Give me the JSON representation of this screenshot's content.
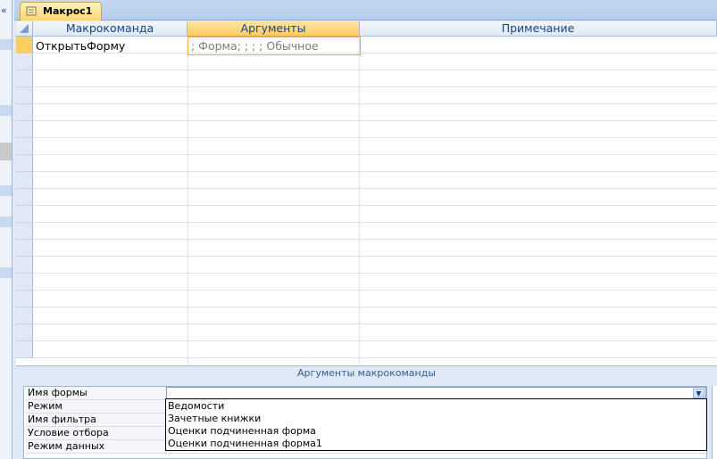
{
  "nav": {
    "collapse_glyph": "«"
  },
  "tab": {
    "title": "Макрос1",
    "icon": "macro-scroll-icon"
  },
  "grid": {
    "headers": {
      "action": "Макрокоманда",
      "arguments": "Аргументы",
      "comment": "Примечание"
    },
    "rows": [
      {
        "action": "ОткрытьФорму",
        "arguments": "; Форма; ; ; ; Обычное",
        "comment": ""
      }
    ]
  },
  "args_panel": {
    "title": "Аргументы макрокоманды",
    "properties": [
      {
        "label": "Имя формы",
        "value": ""
      },
      {
        "label": "Режим",
        "value": ""
      },
      {
        "label": "Имя фильтра",
        "value": ""
      },
      {
        "label": "Условие отбора",
        "value": ""
      },
      {
        "label": "Режим данных",
        "value": ""
      }
    ],
    "dropdown_options": [
      "Ведомости",
      "Зачетные книжки",
      "Оценки подчиненная форма",
      "Оценки подчиненная форма1"
    ]
  },
  "colors": {
    "accent": "#ffcc63",
    "header_text": "#15428b",
    "panel_bg": "#dfe8f6"
  }
}
